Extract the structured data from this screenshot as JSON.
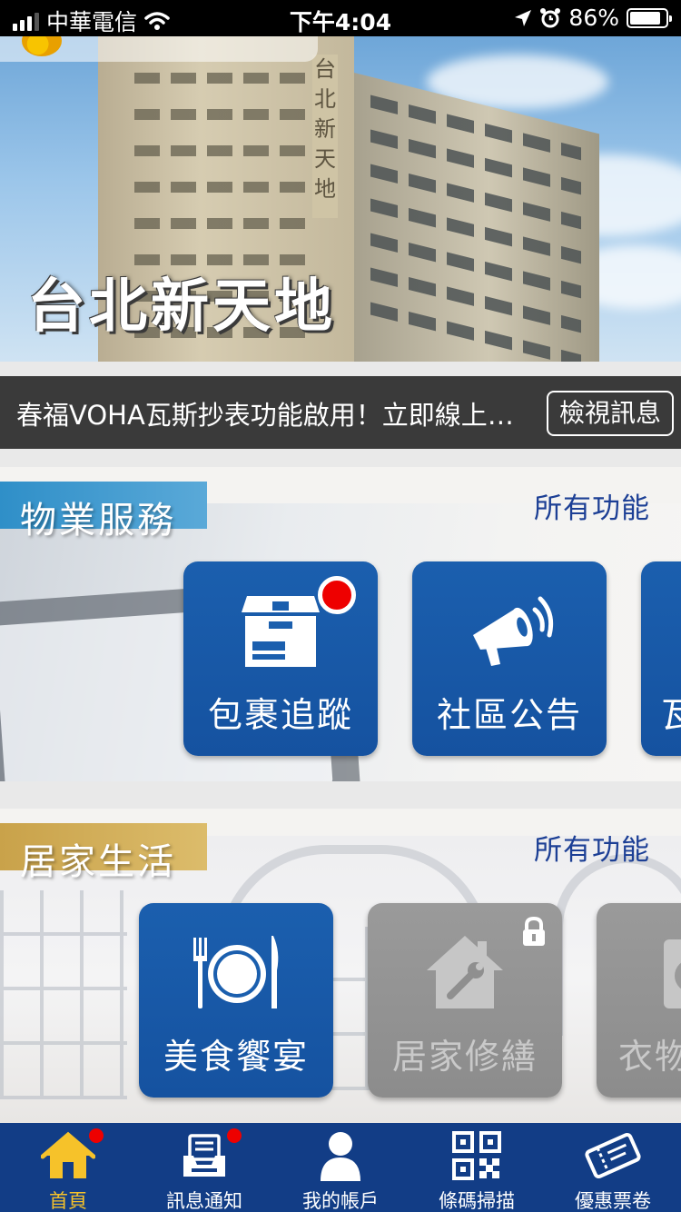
{
  "status_bar": {
    "carrier": "中華電信",
    "time": "下午4:04",
    "battery": "86%",
    "battery_level": 0.86
  },
  "hero": {
    "title": "台北新天地",
    "sign_text": "台北新天地"
  },
  "notice": {
    "text": "春福VOHA瓦斯抄表功能啟用！立即線上抄表",
    "button": "檢視訊息"
  },
  "sections": [
    {
      "title": "物業服務",
      "more_label": "所有功能",
      "tiles": [
        {
          "label": "包裹追蹤",
          "icon": "package-icon",
          "badge": true,
          "locked": false
        },
        {
          "label": "社區公告",
          "icon": "megaphone-icon",
          "badge": false,
          "locked": false
        },
        {
          "label": "瓦",
          "icon": "partial-tile",
          "badge": false,
          "locked": false
        }
      ]
    },
    {
      "title": "居家生活",
      "more_label": "所有功能",
      "tiles": [
        {
          "label": "美食饗宴",
          "icon": "dining-icon",
          "badge": false,
          "locked": false
        },
        {
          "label": "居家修繕",
          "icon": "home-repair-icon",
          "badge": false,
          "locked": true
        },
        {
          "label": "衣物",
          "icon": "laundry-icon",
          "badge": false,
          "locked": false
        }
      ]
    }
  ],
  "tabbar": {
    "colors": {
      "active": "#f6c22a",
      "inactive": "#ffffff",
      "background": "#123d86"
    },
    "tabs": [
      {
        "label": "首頁",
        "icon": "home-icon",
        "active": true,
        "badge": true
      },
      {
        "label": "訊息通知",
        "icon": "inbox-icon",
        "active": false,
        "badge": true
      },
      {
        "label": "我的帳戶",
        "icon": "user-icon",
        "active": false,
        "badge": false
      },
      {
        "label": "條碼掃描",
        "icon": "qr-code-icon",
        "active": false,
        "badge": false
      },
      {
        "label": "優惠票卷",
        "icon": "ticket-icon",
        "active": false,
        "badge": false
      }
    ]
  }
}
